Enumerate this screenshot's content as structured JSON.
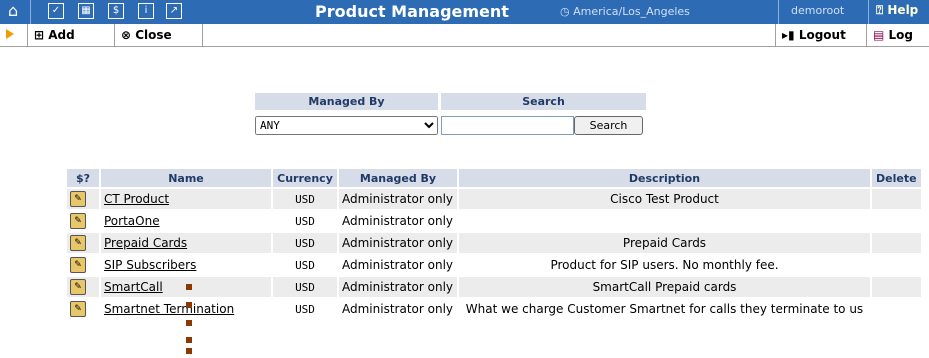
{
  "topbar": {
    "title": "Product Management",
    "timezone": "America/Los_Angeles",
    "user": "demoroot",
    "help": "Help",
    "accent": "#2e6bb5"
  },
  "toolbar": {
    "add": "Add",
    "close": "Close",
    "logout": "Logout",
    "log": "Log"
  },
  "filter": {
    "managed_by_header": "Managed By",
    "search_header": "Search",
    "managed_by_value": "ANY",
    "search_value": "",
    "search_button": "Search"
  },
  "table": {
    "headers": [
      "$?",
      "Name",
      "Currency",
      "Managed By",
      "Description",
      "Delete"
    ],
    "rows": [
      {
        "name": "CT Product",
        "currency": "USD",
        "managed_by": "Administrator only",
        "description": "Cisco Test Product"
      },
      {
        "name": "PortaOne",
        "currency": "USD",
        "managed_by": "Administrator only",
        "description": ""
      },
      {
        "name": "Prepaid Cards",
        "currency": "USD",
        "managed_by": "Administrator only",
        "description": "Prepaid Cards"
      },
      {
        "name": "SIP Subscribers",
        "currency": "USD",
        "managed_by": "Administrator only",
        "description": "Product for SIP users. No monthly fee."
      },
      {
        "name": "SmartCall",
        "currency": "USD",
        "managed_by": "Administrator only",
        "description": "SmartCall Prepaid cards"
      },
      {
        "name": "Smartnet Termination",
        "currency": "USD",
        "managed_by": "Administrator only",
        "description": "What we charge Customer Smartnet for calls they terminate to us"
      }
    ]
  }
}
